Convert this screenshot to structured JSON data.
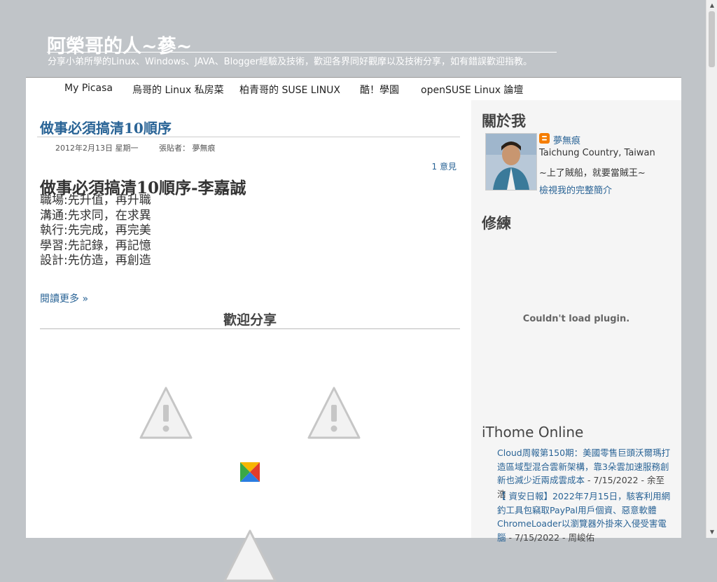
{
  "header": {
    "title": "阿榮哥的人~蔘~",
    "description": "分享小弟所學的Linux、Windows、JAVA、Blogger經驗及技術，歡迎各界同好觀摩以及技術分享，如有錯誤歡迎指教。"
  },
  "nav": {
    "items": [
      "My Picasa",
      "烏哥的 Linux 私房菜",
      "柏青哥的 SUSE LINUX",
      "酷！學園",
      "openSUSE Linux 論壇"
    ]
  },
  "post": {
    "title": "做事必須搞清10順序",
    "date": "2012年2月13日 星期一",
    "author_label": "張貼者：",
    "author": "夢無痕",
    "comments": "1 意見",
    "heading": "做事必須搞清10順序-李嘉誠",
    "lines": [
      "職場:先升值，再升職",
      "溝通:先求同，在求異",
      "執行:先完成，再完美",
      "學習:先記錄，再記憶",
      "設計:先仿造，再創造"
    ],
    "read_more": "閱讀更多 »",
    "share_title": "歡迎分享"
  },
  "sidebar": {
    "about_title": "關於我",
    "profile": {
      "name": "夢無痕",
      "location": "Taichung Country, Taiwan",
      "motto": "~上了賊船，就要當賊王~",
      "full_profile": "檢視我的完整簡介"
    },
    "practice_title": "修練",
    "plugin_message": "Couldn't load plugin.",
    "ithome_title": "iThome Online",
    "feed": [
      {
        "link": "Cloud周報第150期：美國零售巨頭沃爾瑪打造區域型混合雲新架構，靠3朵雲加速服務創新也減少近兩成雲成本",
        "meta": " - 7/15/2022 - 余至浩"
      },
      {
        "link": "【 資安日報】2022年7月15日，駭客利用網釣工具包竊取PayPal用戶個資、惡意軟體ChromeLoader以瀏覽器外掛來入侵受害電腦",
        "meta": " - 7/15/2022 - 周峻佑"
      }
    ]
  },
  "colors": {
    "link": "#2a6496",
    "background": "#c0c4c8"
  }
}
